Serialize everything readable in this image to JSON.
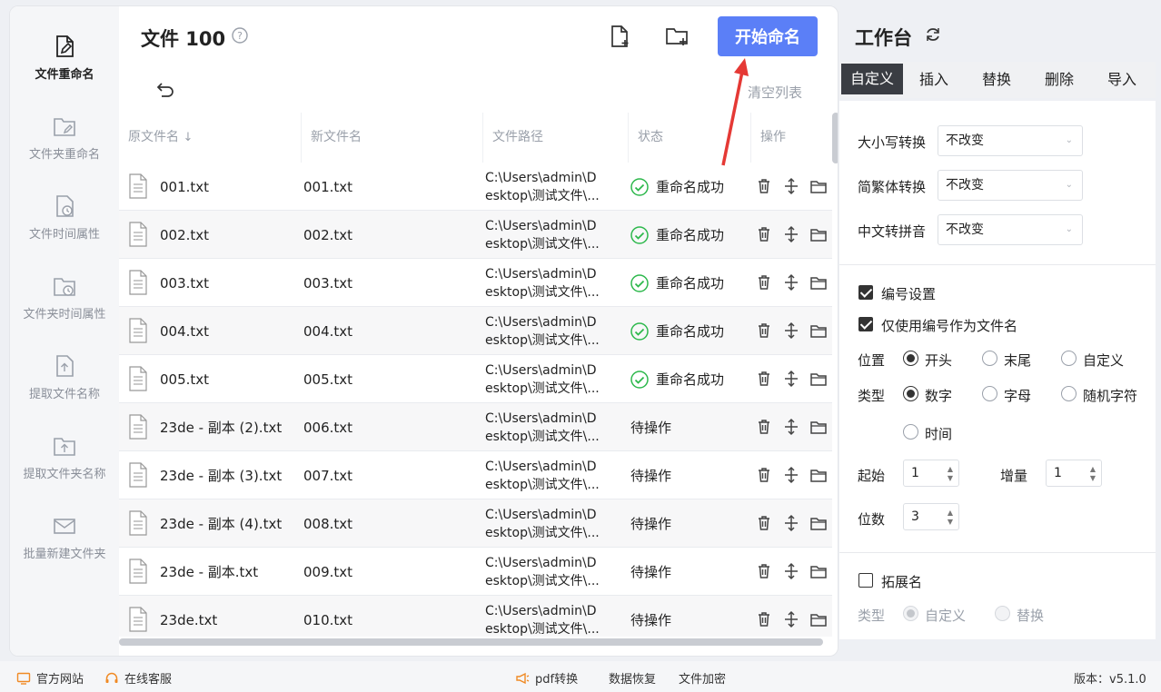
{
  "sidebar": {
    "items": [
      {
        "label": "文件重命名",
        "icon": "file-edit-icon",
        "active": true
      },
      {
        "label": "文件夹重命名",
        "icon": "folder-edit-icon"
      },
      {
        "label": "文件时间属性",
        "icon": "file-clock-icon"
      },
      {
        "label": "文件夹时间属性",
        "icon": "folder-clock-icon"
      },
      {
        "label": "提取文件名称",
        "icon": "file-upload-icon"
      },
      {
        "label": "提取文件夹名称",
        "icon": "folder-upload-icon"
      },
      {
        "label": "批量新建文件夹",
        "icon": "mail-folder-icon"
      }
    ]
  },
  "header": {
    "title": "文件 100",
    "start_button": "开始命名",
    "clear_list": "清空列表"
  },
  "table": {
    "columns": [
      "原文件名",
      "新文件名",
      "文件路径",
      "状态",
      "操作"
    ],
    "rows": [
      {
        "orig": "001.txt",
        "new": "001.txt",
        "path1": "C:\\Users\\admin\\D",
        "path2": "esktop\\测试文件\\...",
        "status": "重命名成功",
        "ok": true
      },
      {
        "orig": "002.txt",
        "new": "002.txt",
        "path1": "C:\\Users\\admin\\D",
        "path2": "esktop\\测试文件\\...",
        "status": "重命名成功",
        "ok": true
      },
      {
        "orig": "003.txt",
        "new": "003.txt",
        "path1": "C:\\Users\\admin\\D",
        "path2": "esktop\\测试文件\\...",
        "status": "重命名成功",
        "ok": true
      },
      {
        "orig": "004.txt",
        "new": "004.txt",
        "path1": "C:\\Users\\admin\\D",
        "path2": "esktop\\测试文件\\...",
        "status": "重命名成功",
        "ok": true
      },
      {
        "orig": "005.txt",
        "new": "005.txt",
        "path1": "C:\\Users\\admin\\D",
        "path2": "esktop\\测试文件\\...",
        "status": "重命名成功",
        "ok": true
      },
      {
        "orig": "23de - 副本 (2).txt",
        "new": "006.txt",
        "path1": "C:\\Users\\admin\\D",
        "path2": "esktop\\测试文件\\...",
        "status": "待操作",
        "ok": false
      },
      {
        "orig": "23de - 副本 (3).txt",
        "new": "007.txt",
        "path1": "C:\\Users\\admin\\D",
        "path2": "esktop\\测试文件\\...",
        "status": "待操作",
        "ok": false
      },
      {
        "orig": "23de - 副本 (4).txt",
        "new": "008.txt",
        "path1": "C:\\Users\\admin\\D",
        "path2": "esktop\\测试文件\\...",
        "status": "待操作",
        "ok": false
      },
      {
        "orig": "23de - 副本.txt",
        "new": "009.txt",
        "path1": "C:\\Users\\admin\\D",
        "path2": "esktop\\测试文件\\...",
        "status": "待操作",
        "ok": false
      },
      {
        "orig": "23de.txt",
        "new": "010.txt",
        "path1": "C:\\Users\\admin\\D",
        "path2": "esktop\\测试文件\\...",
        "status": "待操作",
        "ok": false
      }
    ]
  },
  "panel": {
    "title": "工作台",
    "tabs": [
      "自定义",
      "插入",
      "替换",
      "删除",
      "导入"
    ],
    "active_tab": "自定义",
    "case_label": "大小写转换",
    "case_value": "不改变",
    "trad_label": "简繁体转换",
    "trad_value": "不改变",
    "pinyin_label": "中文转拼音",
    "pinyin_value": "不改变",
    "numbering_label": "编号设置",
    "numbering_checked": true,
    "only_number_label": "仅使用编号作为文件名",
    "only_number_checked": true,
    "position_label": "位置",
    "position_options": [
      "开头",
      "末尾",
      "自定义"
    ],
    "position_selected": "开头",
    "type_label": "类型",
    "type_options": [
      "数字",
      "字母",
      "随机字符",
      "时间"
    ],
    "type_selected": "数字",
    "start_label": "起始",
    "start_value": "1",
    "increment_label": "增量",
    "increment_value": "1",
    "digits_label": "位数",
    "digits_value": "3",
    "ext_label": "拓展名",
    "ext_checked": false,
    "ext_type_label": "类型",
    "ext_type_options": [
      "自定义",
      "替换"
    ],
    "ext_type_selected": "自定义"
  },
  "footer": {
    "website": "官方网站",
    "support": "在线客服",
    "pdf": "pdf转换",
    "recovery": "数据恢复",
    "encrypt": "文件加密",
    "version": "版本：v5.1.0"
  },
  "colors": {
    "accent": "#5b7ff7",
    "success": "#2db84c",
    "arrow": "#e53935"
  }
}
